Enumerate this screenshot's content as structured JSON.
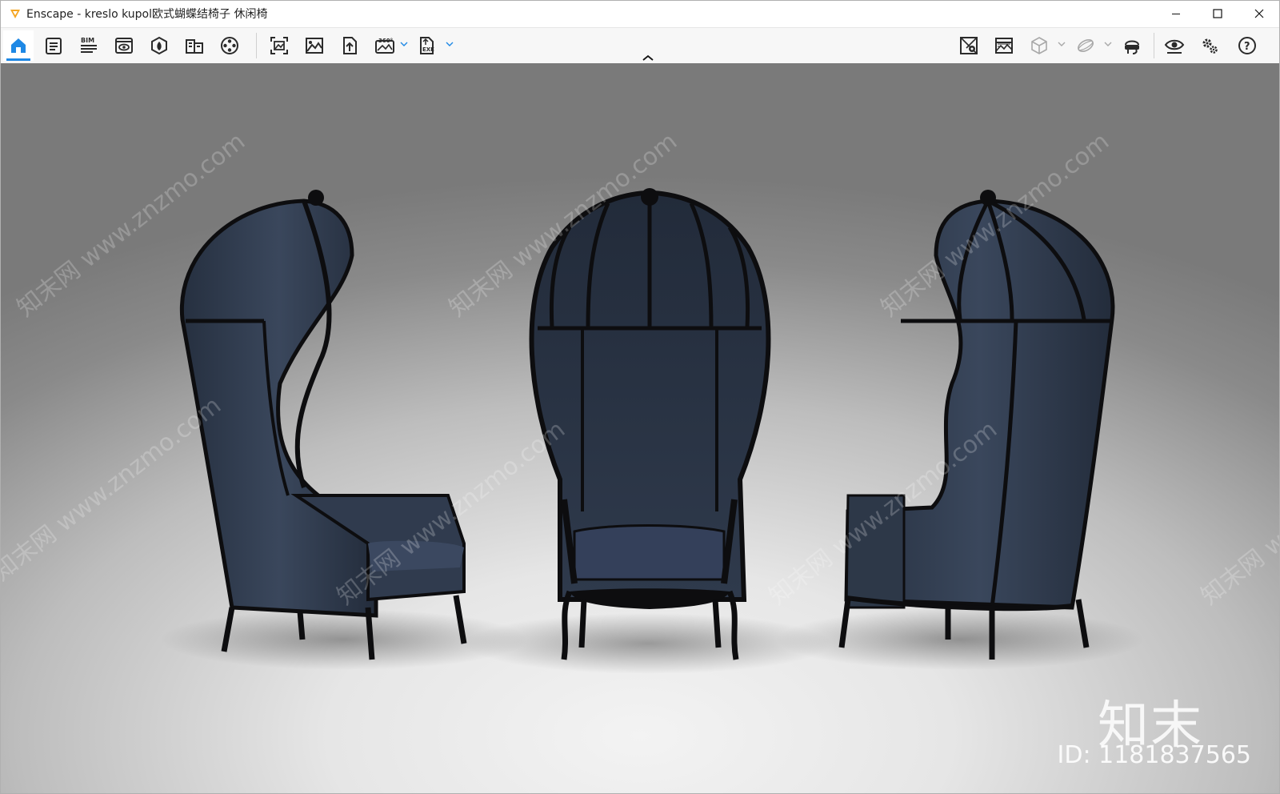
{
  "window": {
    "title": "Enscape - kreslo kupol欧式蝴蝶结椅子 休闲椅",
    "controls": {
      "minimize_icon": "minimize-icon",
      "maximize_icon": "maximize-icon",
      "close_icon": "close-icon"
    }
  },
  "toolbar": {
    "left_buttons": [
      {
        "name": "home-icon",
        "active": true
      },
      {
        "name": "settings-file-icon"
      },
      {
        "name": "bim-icon",
        "label": "BIM"
      },
      {
        "name": "view-icon"
      },
      {
        "name": "asset-library-icon"
      },
      {
        "name": "material-editor-icon"
      },
      {
        "name": "video-editor-icon"
      }
    ],
    "capture_buttons": [
      {
        "name": "screenshot-icon"
      },
      {
        "name": "batch-render-icon"
      },
      {
        "name": "upload-icon"
      },
      {
        "name": "panorama-icon",
        "label": "360°",
        "has_menu": true
      },
      {
        "name": "export-exe-icon",
        "label": "EXE",
        "has_menu": true
      }
    ],
    "right_buttons": [
      {
        "name": "map-icon"
      },
      {
        "name": "sky-icon"
      },
      {
        "name": "cube-icon",
        "has_menu": true
      },
      {
        "name": "orbit-icon",
        "has_menu": true
      },
      {
        "name": "vr-headset-icon"
      },
      {
        "name": "eye-icon"
      },
      {
        "name": "gears-icon"
      },
      {
        "name": "help-icon",
        "label": "?"
      }
    ],
    "colors": {
      "accent": "#1e88e5",
      "icon": "#2b2b2b",
      "disabled": "#a8a8a8"
    }
  },
  "viewport": {
    "watermark_text": "知末网 www.znzmo.com",
    "brand_text": "知末",
    "id_text": "ID: 1181837565",
    "chair_color": "#2f3a4d",
    "frame_color": "#0d0d0f"
  }
}
